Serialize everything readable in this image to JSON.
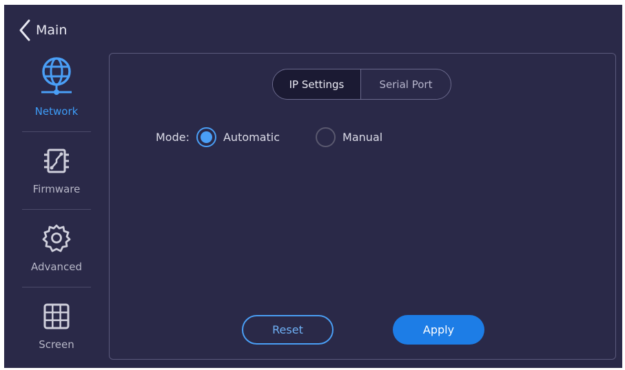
{
  "header": {
    "back_label": "Main"
  },
  "sidebar": {
    "items": [
      {
        "label": "Network",
        "icon": "globe-network-icon",
        "active": true
      },
      {
        "label": "Firmware",
        "icon": "chip-icon",
        "active": false
      },
      {
        "label": "Advanced",
        "icon": "gear-icon",
        "active": false
      },
      {
        "label": "Screen",
        "icon": "grid-icon",
        "active": false
      }
    ]
  },
  "tabs": [
    {
      "label": "IP Settings",
      "selected": true
    },
    {
      "label": "Serial Port",
      "selected": false
    }
  ],
  "mode": {
    "label": "Mode:",
    "options": [
      {
        "label": "Automatic",
        "checked": true
      },
      {
        "label": "Manual",
        "checked": false
      }
    ]
  },
  "buttons": {
    "reset": "Reset",
    "apply": "Apply"
  },
  "colors": {
    "background": "#2a2948",
    "accent": "#4a9ff6",
    "apply": "#1d7de6"
  }
}
